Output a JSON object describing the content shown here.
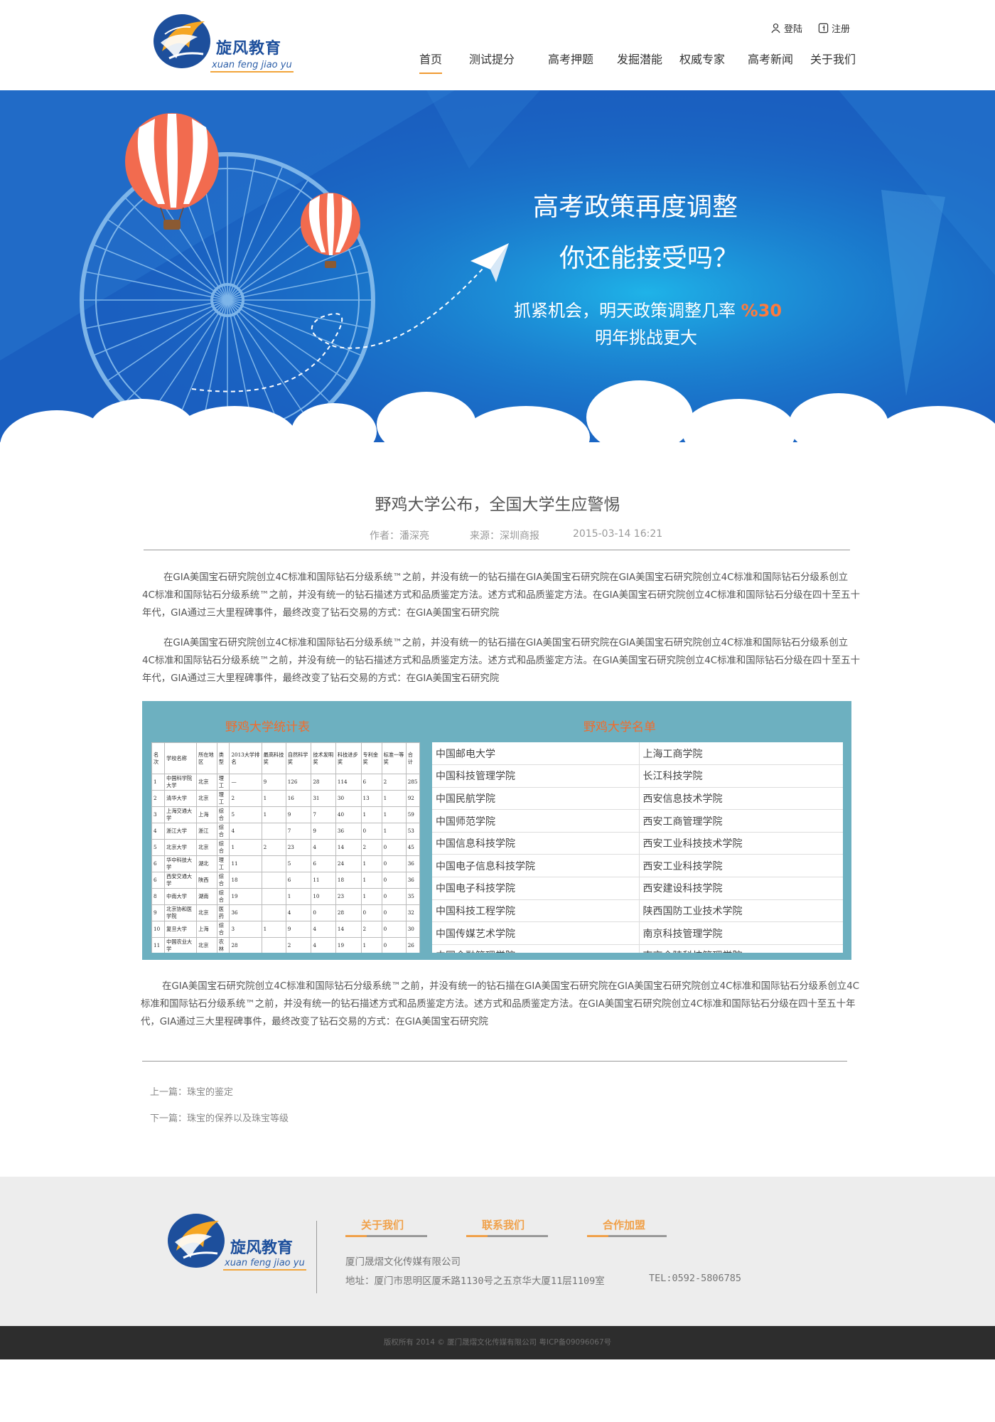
{
  "brand": {
    "name": "旋风教育",
    "pinyin": "xuan feng jiao yu"
  },
  "auth": {
    "login": "登陆",
    "register": "注册"
  },
  "nav": [
    "首页",
    "测试提分",
    "高考押题",
    "发掘潜能",
    "权威专家",
    "高考新闻",
    "关于我们"
  ],
  "banner": {
    "line1": "高考政策再度调整",
    "line2": "你还能接受吗？",
    "line3": "抓紧机会，明天政策调整几率 ",
    "highlight": "%30",
    "line4": "明年挑战更大"
  },
  "article": {
    "title": "野鸡大学公布，全国大学生应警惕",
    "author": "作者：潘深亮",
    "source": "来源：深圳商报",
    "date": "2015-03-14 16:21",
    "paragraphs": [
      "在GIA美国宝石研究院创立4C标准和国际钻石分级系统™之前，并没有统一的钻石描在GIA美国宝石研究院在GIA美国宝石研究院创立4C标准和国际钻石分级系创立4C标准和国际钻石分级系统™之前，并没有统一的钻石描述方式和品质鉴定方法。述方式和品质鉴定方法。在GIA美国宝石研究院创立4C标准和国际钻石分级在四十至五十年代，GIA通过三大里程碑事件，最终改变了钻石交易的方式：在GIA美国宝石研究院",
      "在GIA美国宝石研究院创立4C标准和国际钻石分级系统™之前，并没有统一的钻石描在GIA美国宝石研究院在GIA美国宝石研究院创立4C标准和国际钻石分级系创立4C标准和国际钻石分级系统™之前，并没有统一的钻石描述方式和品质鉴定方法。述方式和品质鉴定方法。在GIA美国宝石研究院创立4C标准和国际钻石分级在四十至五十年代，GIA通过三大里程碑事件，最终改变了钻石交易的方式：在GIA美国宝石研究院",
      "在GIA美国宝石研究院创立4C标准和国际钻石分级系统™之前，并没有统一的钻石描在GIA美国宝石研究院在GIA美国宝石研究院创立4C标准和国际钻石分级系创立4C标准和国际钻石分级系统™之前，并没有统一的钻石描述方式和品质鉴定方法。述方式和品质鉴定方法。在GIA美国宝石研究院创立4C标准和国际钻石分级在四十至五十年代，GIA通过三大里程碑事件，最终改变了钻石交易的方式：在GIA美国宝石研究院"
    ]
  },
  "stats": {
    "title": "野鸡大学统计表",
    "headers": [
      "名次",
      "学校名称",
      "所在地区",
      "类型",
      "2013大学排名",
      "最高科技奖",
      "自然科学奖",
      "技术发明奖",
      "科技进步奖",
      "专利金奖",
      "标准一等奖",
      "合计"
    ],
    "rows": [
      [
        "1",
        "中国科学院大学",
        "北京",
        "理工",
        "—",
        "9",
        "126",
        "28",
        "114",
        "6",
        "2",
        "285"
      ],
      [
        "2",
        "清华大学",
        "北京",
        "理工",
        "2",
        "1",
        "16",
        "31",
        "30",
        "13",
        "1",
        "92"
      ],
      [
        "3",
        "上海交通大学",
        "上海",
        "综合",
        "5",
        "1",
        "9",
        "7",
        "40",
        "1",
        "1",
        "59"
      ],
      [
        "4",
        "浙江大学",
        "浙江",
        "综合",
        "4",
        "",
        "7",
        "9",
        "36",
        "0",
        "1",
        "53"
      ],
      [
        "5",
        "北京大学",
        "北京",
        "综合",
        "1",
        "2",
        "23",
        "4",
        "14",
        "2",
        "0",
        "45"
      ],
      [
        "6",
        "华中科技大学",
        "湖北",
        "理工",
        "11",
        "",
        "5",
        "6",
        "24",
        "1",
        "0",
        "36"
      ],
      [
        "6",
        "西安交通大学",
        "陕西",
        "综合",
        "18",
        "",
        "6",
        "11",
        "18",
        "1",
        "0",
        "36"
      ],
      [
        "8",
        "中南大学",
        "湖南",
        "综合",
        "19",
        "",
        "1",
        "10",
        "23",
        "1",
        "0",
        "35"
      ],
      [
        "9",
        "北京协和医学院",
        "北京",
        "医药",
        "36",
        "",
        "4",
        "0",
        "28",
        "0",
        "0",
        "32"
      ],
      [
        "10",
        "复旦大学",
        "上海",
        "综合",
        "3",
        "1",
        "9",
        "4",
        "14",
        "2",
        "0",
        "30"
      ],
      [
        "11",
        "中国农业大学",
        "北京",
        "农林",
        "28",
        "",
        "2",
        "4",
        "19",
        "1",
        "0",
        "26"
      ]
    ]
  },
  "names": {
    "title": "野鸡大学名单",
    "rows": [
      [
        "中国邮电大学",
        "上海工商学院"
      ],
      [
        "中国科技管理学院",
        "长江科技学院"
      ],
      [
        "中国民航学院",
        "西安信息技术学院"
      ],
      [
        "中国师范学院",
        "西安工商管理学院"
      ],
      [
        "中国信息科技学院",
        "西安工业科技技术学院"
      ],
      [
        "中国电子信息科技学院",
        "西安工业科技学院"
      ],
      [
        "中国电子科技学院",
        "西安建设科技学院"
      ],
      [
        "中国科技工程学院",
        "陕西国防工业技术学院"
      ],
      [
        "中国传媒艺术学院",
        "南京科技管理学院"
      ],
      [
        "中国金融管理学院",
        "南京金陵科技管理学院"
      ]
    ]
  },
  "pager": {
    "prev": "上一篇：珠宝的鉴定",
    "next": "下一篇：珠宝的保养以及珠宝等级"
  },
  "footer": {
    "links": [
      "关于我们",
      "联系我们",
      "合作加盟"
    ],
    "company": "厦门晟熠文化传媒有限公司",
    "address": "地址：厦门市思明区厦禾路1130号之五京华大厦11层1109室",
    "tel": "TEL:0592-5806785",
    "copyright": "版权所有 2014 © 厦门晟熠文化传媒有限公司 粤ICP备09096067号"
  },
  "colors": {
    "banner_bg": "#1667c4",
    "accent_orange": "#f09a32",
    "highlight": "#ff7a3c",
    "panel_bg": "#6db0c0",
    "brand_blue": "#1d4f9c"
  },
  "icons": [
    "user-icon",
    "register-icon",
    "logo-swirl-icon",
    "paper-plane-icon",
    "hot-air-balloon-icon",
    "ferris-wheel-icon"
  ]
}
